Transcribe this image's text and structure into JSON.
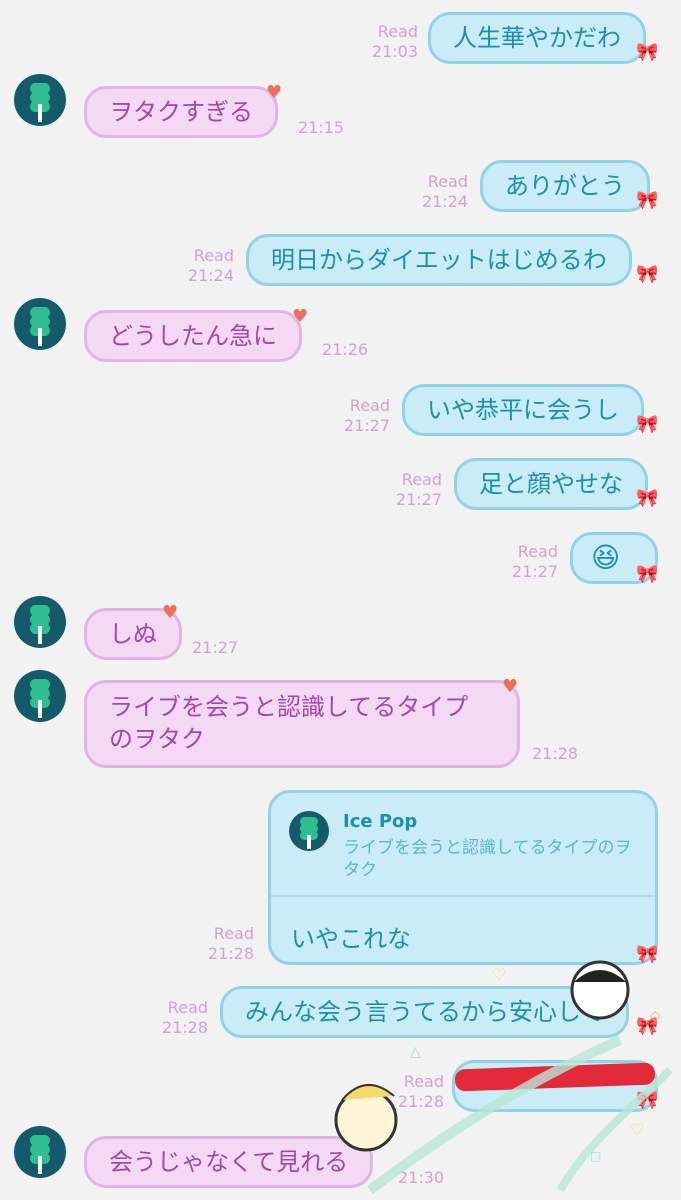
{
  "contact_name": "Ice Pop",
  "colors": {
    "outgoing_bg": "#c9ecf7",
    "incoming_bg": "#f3d9f4",
    "outgoing_text": "#1b8fb3",
    "incoming_text": "#a447ad",
    "read_color": "#d59ed9"
  },
  "messages": [
    {
      "dir": "out",
      "text": "人生華やかだわ",
      "read": "Read",
      "time": "21:03"
    },
    {
      "dir": "in",
      "text": "ヲタクすぎる",
      "time": "21:15"
    },
    {
      "dir": "out",
      "text": "ありがとう",
      "read": "Read",
      "time": "21:24"
    },
    {
      "dir": "out",
      "text": "明日からダイエットはじめるわ",
      "read": "Read",
      "time": "21:24"
    },
    {
      "dir": "in",
      "text": "どうしたん急に",
      "time": "21:26"
    },
    {
      "dir": "out",
      "text": "いや恭平に会うし",
      "read": "Read",
      "time": "21:27"
    },
    {
      "dir": "out",
      "text": "足と顔やせな",
      "read": "Read",
      "time": "21:27"
    },
    {
      "dir": "out",
      "text": "😆",
      "read": "Read",
      "time": "21:27"
    },
    {
      "dir": "in",
      "text": "しぬ",
      "time": "21:27"
    },
    {
      "dir": "in",
      "text_line1": "ライブを会うと認識してるタイプ",
      "text_line2": "のヲタク",
      "time": "21:28"
    },
    {
      "dir": "out",
      "quote_name": "Ice Pop",
      "quote_text": "ライブを会うと認識してるタイプのヲタク",
      "text": "いやこれな",
      "read": "Read",
      "time": "21:28"
    },
    {
      "dir": "out",
      "text": "みんな会う言うてるから安心して",
      "read": "Read",
      "time": "21:28"
    },
    {
      "dir": "out",
      "text": "",
      "read": "Read",
      "time": "21:28"
    },
    {
      "dir": "in",
      "text": "会うじゃなくて見れる",
      "time": "21:30"
    }
  ]
}
